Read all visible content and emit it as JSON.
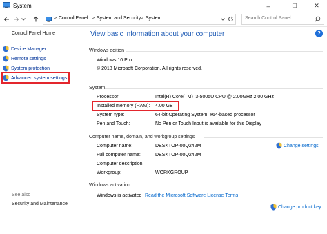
{
  "window": {
    "title": "System",
    "controls": {
      "minimize": "–",
      "maximize": "☐",
      "close": "✕"
    }
  },
  "nav": {
    "back_icon": "arrow-left-icon",
    "forward_icon": "arrow-right-icon",
    "up_icon": "arrow-up-icon",
    "breadcrumb": [
      "Control Panel",
      "System and Security",
      "System"
    ],
    "separator": ">",
    "search_placeholder": "Search Control Panel"
  },
  "sidebar": {
    "home": "Control Panel Home",
    "items": [
      {
        "label": "Device Manager",
        "icon": "shield-icon"
      },
      {
        "label": "Remote settings",
        "icon": "shield-icon"
      },
      {
        "label": "System protection",
        "icon": "shield-icon"
      },
      {
        "label": "Advanced system settings",
        "icon": "shield-icon"
      }
    ],
    "see_also_title": "See also",
    "see_also_items": [
      "Security and Maintenance"
    ]
  },
  "main": {
    "heading": "View basic information about your computer",
    "edition": {
      "title": "Windows edition",
      "name": "Windows 10 Pro",
      "copyright": "© 2018 Microsoft Corporation. All rights reserved."
    },
    "system": {
      "title": "System",
      "rows": [
        {
          "label": "Processor:",
          "value": "Intel(R) Core(TM) i3-5005U CPU @ 2.00GHz   2.00 GHz"
        },
        {
          "label": "Installed memory (RAM):",
          "value": "4.00 GB"
        },
        {
          "label": "System type:",
          "value": "64-bit Operating System, x64-based processor"
        },
        {
          "label": "Pen and Touch:",
          "value": "No Pen or Touch Input is available for this Display"
        }
      ]
    },
    "computer_name": {
      "title": "Computer name, domain, and workgroup settings",
      "change_label": "Change settings",
      "rows": [
        {
          "label": "Computer name:",
          "value": "DESKTOP-00Q242M"
        },
        {
          "label": "Full computer name:",
          "value": "DESKTOP-00Q242M"
        },
        {
          "label": "Computer description:",
          "value": ""
        },
        {
          "label": "Workgroup:",
          "value": "WORKGROUP"
        }
      ]
    },
    "activation": {
      "title": "Windows activation",
      "status": "Windows is activated",
      "terms_link": "Read the Microsoft Software License Terms",
      "change_key": "Change product key"
    }
  },
  "colors": {
    "accent": "#1e5bb5",
    "link": "#0066cc",
    "highlight": "#e3262d",
    "windows_logo": "#00a4ef"
  }
}
